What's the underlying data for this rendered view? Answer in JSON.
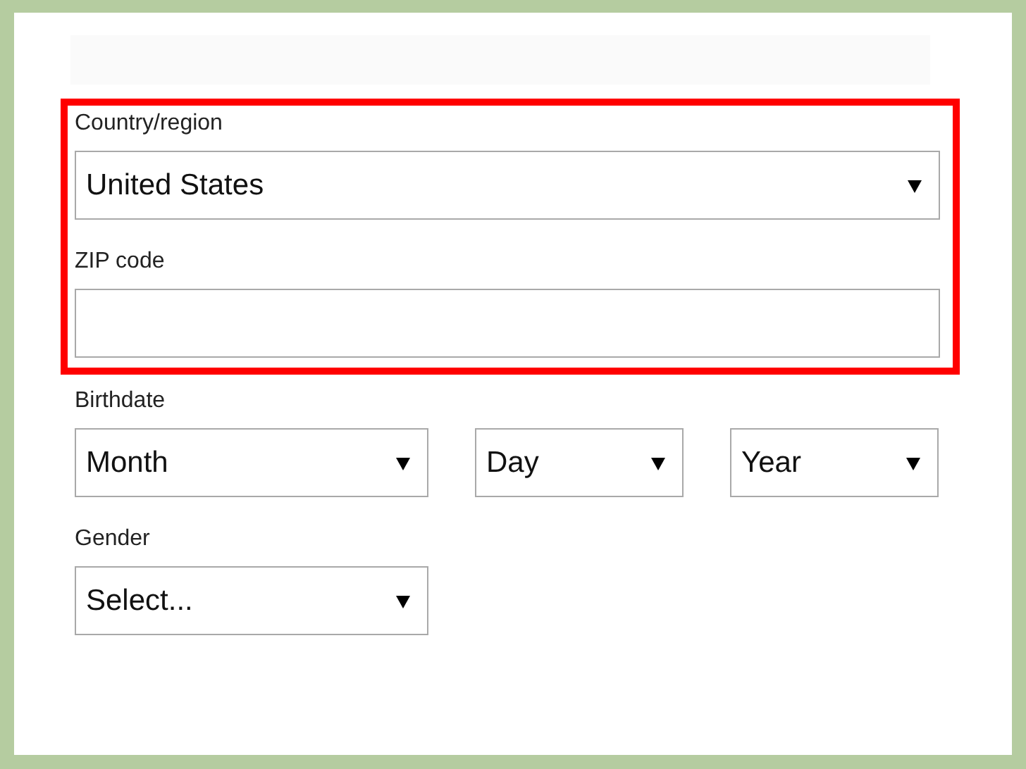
{
  "sections": [
    {
      "highlighted": true,
      "fields": [
        {
          "label": "Country/region",
          "controls": [
            {
              "kind": "dropdown",
              "value": "United States"
            }
          ]
        },
        {
          "label": "ZIP code",
          "controls": [
            {
              "kind": "text"
            }
          ]
        }
      ]
    },
    {
      "highlighted": false,
      "fields": [
        {
          "label": "Birthdate",
          "controls": [
            {
              "kind": "dropdown",
              "value": "Month"
            },
            {
              "kind": "dropdown",
              "value": "Day"
            },
            {
              "kind": "dropdown",
              "value": "Year"
            }
          ]
        },
        {
          "label": "Gender",
          "controls": [
            {
              "kind": "dropdown",
              "value": "Select..."
            }
          ]
        }
      ]
    }
  ]
}
